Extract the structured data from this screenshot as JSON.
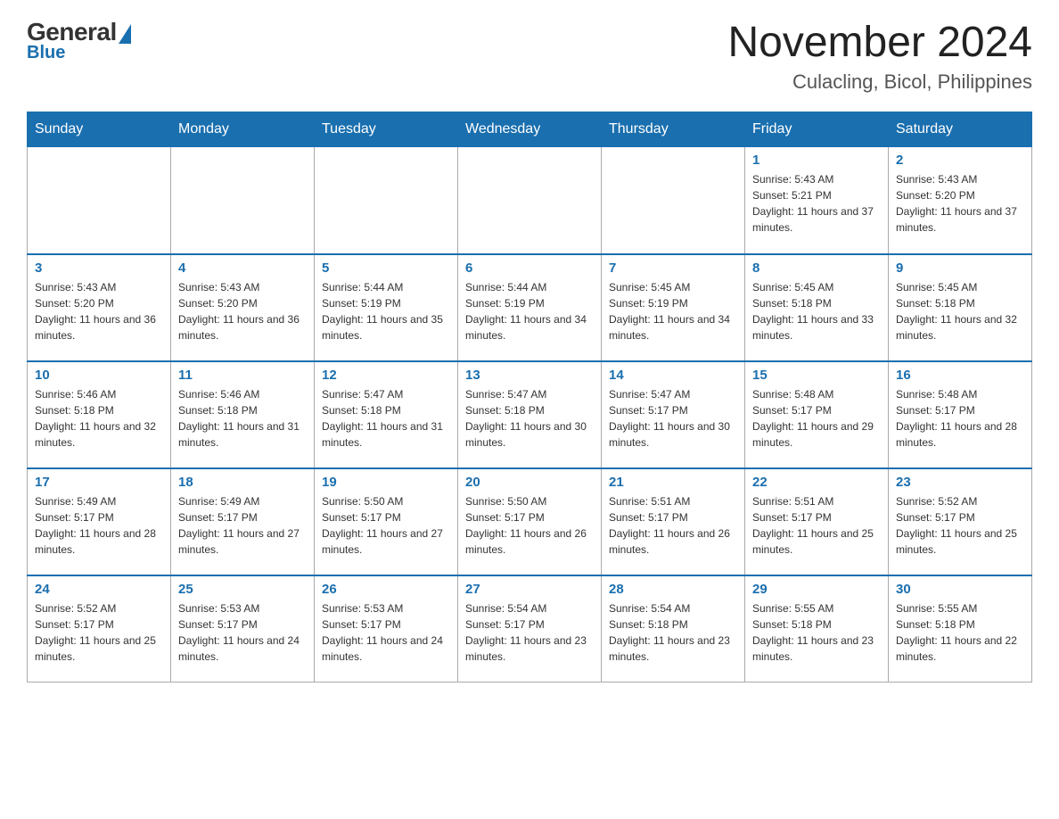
{
  "logo": {
    "general": "General",
    "blue": "Blue"
  },
  "header": {
    "month": "November 2024",
    "location": "Culacling, Bicol, Philippines"
  },
  "weekdays": [
    "Sunday",
    "Monday",
    "Tuesday",
    "Wednesday",
    "Thursday",
    "Friday",
    "Saturday"
  ],
  "weeks": [
    [
      {
        "day": "",
        "info": ""
      },
      {
        "day": "",
        "info": ""
      },
      {
        "day": "",
        "info": ""
      },
      {
        "day": "",
        "info": ""
      },
      {
        "day": "",
        "info": ""
      },
      {
        "day": "1",
        "info": "Sunrise: 5:43 AM\nSunset: 5:21 PM\nDaylight: 11 hours and 37 minutes."
      },
      {
        "day": "2",
        "info": "Sunrise: 5:43 AM\nSunset: 5:20 PM\nDaylight: 11 hours and 37 minutes."
      }
    ],
    [
      {
        "day": "3",
        "info": "Sunrise: 5:43 AM\nSunset: 5:20 PM\nDaylight: 11 hours and 36 minutes."
      },
      {
        "day": "4",
        "info": "Sunrise: 5:43 AM\nSunset: 5:20 PM\nDaylight: 11 hours and 36 minutes."
      },
      {
        "day": "5",
        "info": "Sunrise: 5:44 AM\nSunset: 5:19 PM\nDaylight: 11 hours and 35 minutes."
      },
      {
        "day": "6",
        "info": "Sunrise: 5:44 AM\nSunset: 5:19 PM\nDaylight: 11 hours and 34 minutes."
      },
      {
        "day": "7",
        "info": "Sunrise: 5:45 AM\nSunset: 5:19 PM\nDaylight: 11 hours and 34 minutes."
      },
      {
        "day": "8",
        "info": "Sunrise: 5:45 AM\nSunset: 5:18 PM\nDaylight: 11 hours and 33 minutes."
      },
      {
        "day": "9",
        "info": "Sunrise: 5:45 AM\nSunset: 5:18 PM\nDaylight: 11 hours and 32 minutes."
      }
    ],
    [
      {
        "day": "10",
        "info": "Sunrise: 5:46 AM\nSunset: 5:18 PM\nDaylight: 11 hours and 32 minutes."
      },
      {
        "day": "11",
        "info": "Sunrise: 5:46 AM\nSunset: 5:18 PM\nDaylight: 11 hours and 31 minutes."
      },
      {
        "day": "12",
        "info": "Sunrise: 5:47 AM\nSunset: 5:18 PM\nDaylight: 11 hours and 31 minutes."
      },
      {
        "day": "13",
        "info": "Sunrise: 5:47 AM\nSunset: 5:18 PM\nDaylight: 11 hours and 30 minutes."
      },
      {
        "day": "14",
        "info": "Sunrise: 5:47 AM\nSunset: 5:17 PM\nDaylight: 11 hours and 30 minutes."
      },
      {
        "day": "15",
        "info": "Sunrise: 5:48 AM\nSunset: 5:17 PM\nDaylight: 11 hours and 29 minutes."
      },
      {
        "day": "16",
        "info": "Sunrise: 5:48 AM\nSunset: 5:17 PM\nDaylight: 11 hours and 28 minutes."
      }
    ],
    [
      {
        "day": "17",
        "info": "Sunrise: 5:49 AM\nSunset: 5:17 PM\nDaylight: 11 hours and 28 minutes."
      },
      {
        "day": "18",
        "info": "Sunrise: 5:49 AM\nSunset: 5:17 PM\nDaylight: 11 hours and 27 minutes."
      },
      {
        "day": "19",
        "info": "Sunrise: 5:50 AM\nSunset: 5:17 PM\nDaylight: 11 hours and 27 minutes."
      },
      {
        "day": "20",
        "info": "Sunrise: 5:50 AM\nSunset: 5:17 PM\nDaylight: 11 hours and 26 minutes."
      },
      {
        "day": "21",
        "info": "Sunrise: 5:51 AM\nSunset: 5:17 PM\nDaylight: 11 hours and 26 minutes."
      },
      {
        "day": "22",
        "info": "Sunrise: 5:51 AM\nSunset: 5:17 PM\nDaylight: 11 hours and 25 minutes."
      },
      {
        "day": "23",
        "info": "Sunrise: 5:52 AM\nSunset: 5:17 PM\nDaylight: 11 hours and 25 minutes."
      }
    ],
    [
      {
        "day": "24",
        "info": "Sunrise: 5:52 AM\nSunset: 5:17 PM\nDaylight: 11 hours and 25 minutes."
      },
      {
        "day": "25",
        "info": "Sunrise: 5:53 AM\nSunset: 5:17 PM\nDaylight: 11 hours and 24 minutes."
      },
      {
        "day": "26",
        "info": "Sunrise: 5:53 AM\nSunset: 5:17 PM\nDaylight: 11 hours and 24 minutes."
      },
      {
        "day": "27",
        "info": "Sunrise: 5:54 AM\nSunset: 5:17 PM\nDaylight: 11 hours and 23 minutes."
      },
      {
        "day": "28",
        "info": "Sunrise: 5:54 AM\nSunset: 5:18 PM\nDaylight: 11 hours and 23 minutes."
      },
      {
        "day": "29",
        "info": "Sunrise: 5:55 AM\nSunset: 5:18 PM\nDaylight: 11 hours and 23 minutes."
      },
      {
        "day": "30",
        "info": "Sunrise: 5:55 AM\nSunset: 5:18 PM\nDaylight: 11 hours and 22 minutes."
      }
    ]
  ]
}
